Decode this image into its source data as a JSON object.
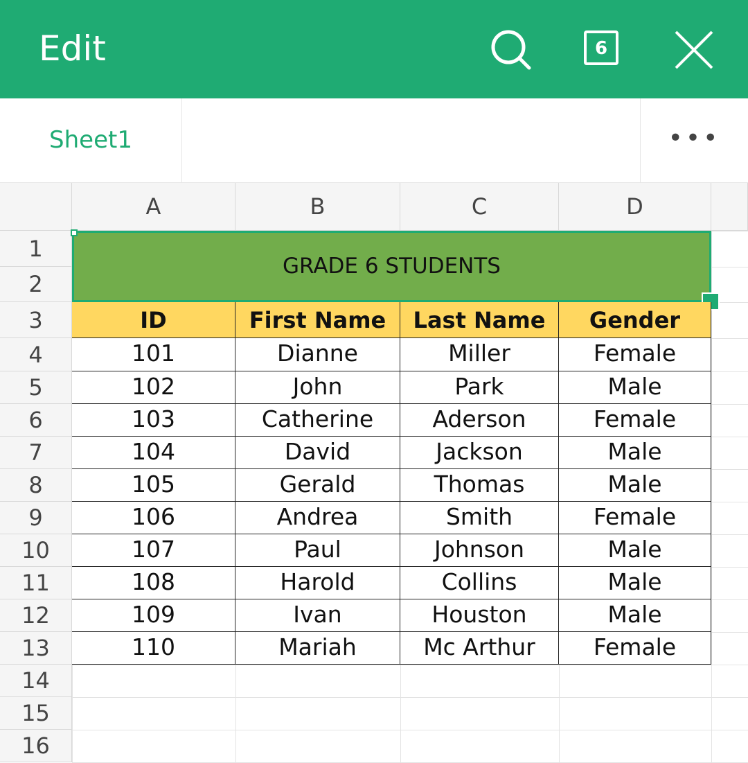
{
  "appbar": {
    "title": "Edit",
    "sheet_count": "6"
  },
  "tabbar": {
    "active_sheet": "Sheet1",
    "more_label": "•••"
  },
  "grid": {
    "columns": [
      "A",
      "B",
      "C",
      "D"
    ],
    "rows": [
      "1",
      "2",
      "3",
      "4",
      "5",
      "6",
      "7",
      "8",
      "9",
      "10",
      "11",
      "12",
      "13",
      "14",
      "15",
      "16"
    ],
    "title": "GRADE 6 STUDENTS",
    "headers": [
      "ID",
      "First Name",
      "Last Name",
      "Gender"
    ],
    "records": [
      [
        "101",
        "Dianne",
        "Miller",
        "Female"
      ],
      [
        "102",
        "John",
        "Park",
        "Male"
      ],
      [
        "103",
        "Catherine",
        "Aderson",
        "Female"
      ],
      [
        "104",
        "David",
        "Jackson",
        "Male"
      ],
      [
        "105",
        "Gerald",
        "Thomas",
        "Male"
      ],
      [
        "106",
        "Andrea",
        "Smith",
        "Female"
      ],
      [
        "107",
        "Paul",
        "Johnson",
        "Male"
      ],
      [
        "108",
        "Harold",
        "Collins",
        "Male"
      ],
      [
        "109",
        "Ivan",
        "Houston",
        "Male"
      ],
      [
        "110",
        "Mariah",
        "Mc Arthur",
        "Female"
      ]
    ]
  },
  "colors": {
    "brand_green": "#1fab73",
    "title_fill": "#72ad4b",
    "header_fill": "#ffd760"
  }
}
